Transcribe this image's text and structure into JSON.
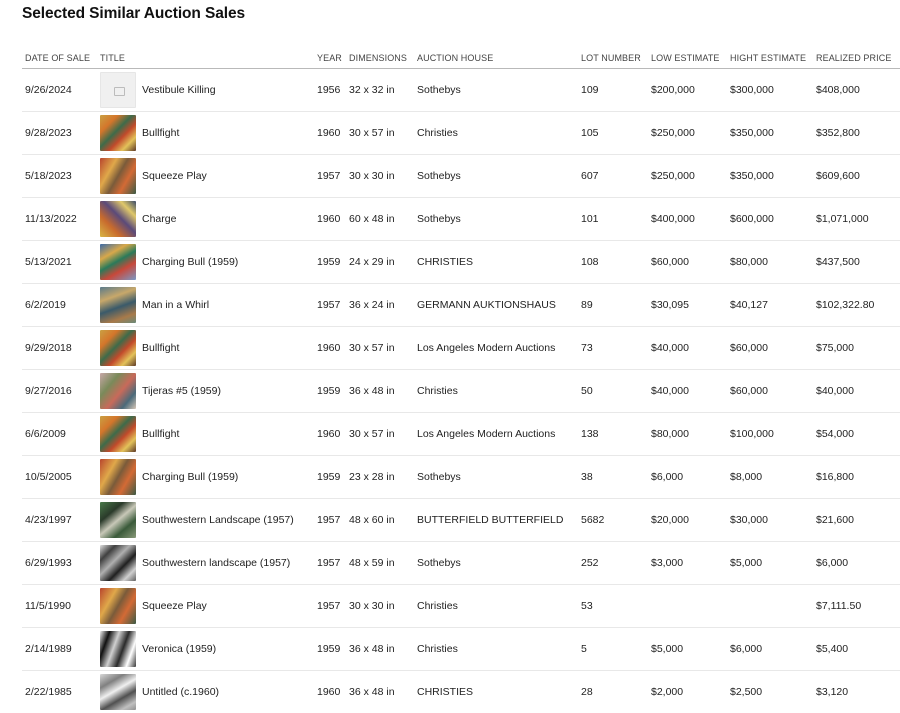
{
  "page": {
    "title": "Selected Similar Auction Sales"
  },
  "table": {
    "headers": [
      "DATE OF SALE",
      "TITLE",
      "YEAR",
      "DIMENSIONS",
      "AUCTION HOUSE",
      "LOT NUMBER",
      "LOW ESTIMATE",
      "HIGHT ESTIMATE",
      "REALIZED PRICE"
    ],
    "rows": [
      {
        "date": "9/26/2024",
        "title": "Vestibule Killing",
        "year": "1956",
        "dimensions": "32 x 32 in",
        "house": "Sothebys",
        "lot": "109",
        "low": "$200,000",
        "high": "$300,000",
        "price": "$408,000",
        "thumb": "placeholder"
      },
      {
        "date": "9/28/2023",
        "title": "Bullfight",
        "year": "1960",
        "dimensions": "30 x 57 in",
        "house": "Christies",
        "lot": "105",
        "low": "$250,000",
        "high": "$350,000",
        "price": "$352,800",
        "thumb": "t-warm"
      },
      {
        "date": "5/18/2023",
        "title": "Squeeze Play",
        "year": "1957",
        "dimensions": "30 x 30 in",
        "house": "Sothebys",
        "lot": "607",
        "low": "$250,000",
        "high": "$350,000",
        "price": "$609,600",
        "thumb": "t-red"
      },
      {
        "date": "11/13/2022",
        "title": "Charge",
        "year": "1960",
        "dimensions": "60 x 48 in",
        "house": "Sothebys",
        "lot": "101",
        "low": "$400,000",
        "high": "$600,000",
        "price": "$1,071,000",
        "thumb": "t-purple"
      },
      {
        "date": "5/13/2021",
        "title": "Charging Bull (1959)",
        "year": "1959",
        "dimensions": "24 x 29 in",
        "house": "CHRISTIES",
        "lot": "108",
        "low": "$60,000",
        "high": "$80,000",
        "price": "$437,500",
        "thumb": "t-blue"
      },
      {
        "date": "6/2/2019",
        "title": "Man in a Whirl",
        "year": "1957",
        "dimensions": "36 x 24 in",
        "house": "GERMANN AUKTIONSHAUS",
        "lot": "89",
        "low": "$30,095",
        "high": "$40,127",
        "price": "$102,322.80",
        "thumb": "t-teal"
      },
      {
        "date": "9/29/2018",
        "title": "Bullfight",
        "year": "1960",
        "dimensions": "30 x 57 in",
        "house": "Los Angeles Modern Auctions",
        "lot": "73",
        "low": "$40,000",
        "high": "$60,000",
        "price": "$75,000",
        "thumb": "t-warm"
      },
      {
        "date": "9/27/2016",
        "title": "Tijeras #5 (1959)",
        "year": "1959",
        "dimensions": "36 x 48 in",
        "house": "Christies",
        "lot": "50",
        "low": "$40,000",
        "high": "$60,000",
        "price": "$40,000",
        "thumb": "t-pink"
      },
      {
        "date": "6/6/2009",
        "title": "Bullfight",
        "year": "1960",
        "dimensions": "30 x 57 in",
        "house": "Los Angeles Modern Auctions",
        "lot": "138",
        "low": "$80,000",
        "high": "$100,000",
        "price": "$54,000",
        "thumb": "t-warm"
      },
      {
        "date": "10/5/2005",
        "title": "Charging Bull (1959)",
        "year": "1959",
        "dimensions": "23 x 28 in",
        "house": "Sothebys",
        "lot": "38",
        "low": "$6,000",
        "high": "$8,000",
        "price": "$16,800",
        "thumb": "t-red"
      },
      {
        "date": "4/23/1997",
        "title": "Southwestern Landscape (1957)",
        "year": "1957",
        "dimensions": "48 x 60 in",
        "house": "BUTTERFIELD BUTTERFIELD",
        "lot": "5682",
        "low": "$20,000",
        "high": "$30,000",
        "price": "$21,600",
        "thumb": "t-green"
      },
      {
        "date": "6/29/1993",
        "title": "Southwestern landscape (1957)",
        "year": "1957",
        "dimensions": "48 x 59 in",
        "house": "Sothebys",
        "lot": "252",
        "low": "$3,000",
        "high": "$5,000",
        "price": "$6,000",
        "thumb": "t-gray"
      },
      {
        "date": "11/5/1990",
        "title": "Squeeze Play",
        "year": "1957",
        "dimensions": "30 x 30 in",
        "house": "Christies",
        "lot": "53",
        "low": "",
        "high": "",
        "price": "$7,111.50",
        "thumb": "t-red"
      },
      {
        "date": "2/14/1989",
        "title": "Veronica (1959)",
        "year": "1959",
        "dimensions": "36 x 48 in",
        "house": "Christies",
        "lot": "5",
        "low": "$5,000",
        "high": "$6,000",
        "price": "$5,400",
        "thumb": "t-bw"
      },
      {
        "date": "2/22/1985",
        "title": "Untitled (c.1960)",
        "year": "1960",
        "dimensions": "36 x 48 in",
        "house": "CHRISTIES",
        "lot": "28",
        "low": "$2,000",
        "high": "$2,500",
        "price": "$3,120",
        "thumb": "t-silver"
      }
    ]
  }
}
